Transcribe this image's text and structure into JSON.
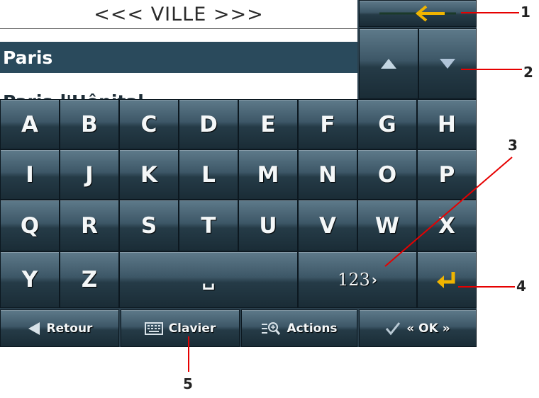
{
  "header": {
    "title": "<<< VILLE >>>"
  },
  "list": {
    "items": [
      "Paris",
      "Paris-l'Hôpital"
    ]
  },
  "keyboard": {
    "rows": [
      [
        "A",
        "B",
        "C",
        "D",
        "E",
        "F",
        "G",
        "H"
      ],
      [
        "I",
        "J",
        "K",
        "L",
        "M",
        "N",
        "O",
        "P"
      ],
      [
        "Q",
        "R",
        "S",
        "T",
        "U",
        "V",
        "W",
        "X"
      ],
      [
        "Y",
        "Z"
      ]
    ],
    "space_label": "␣",
    "numeric_label": "123",
    "numeric_suffix": "›"
  },
  "toolbar": {
    "back_label": "Retour",
    "keyboard_label": "Clavier",
    "actions_label": "Actions",
    "ok_label": "« OK »"
  },
  "callouts": [
    "1",
    "2",
    "3",
    "4",
    "5"
  ],
  "colors": {
    "accent": "#f0b400",
    "callout": "#e60000",
    "panel": "#2a3f4c"
  }
}
